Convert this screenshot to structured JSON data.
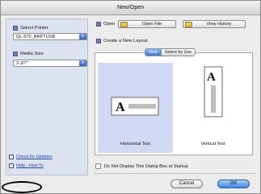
{
  "window": {
    "title": "New/Open"
  },
  "sidebar": {
    "printer": {
      "label": "Select Printer",
      "value": "QL-570_BRPTUSB"
    },
    "media": {
      "label": "Media Size",
      "value": "2-3/7\""
    },
    "links": [
      {
        "label": "Check for Updates"
      },
      {
        "label": "Help - How To"
      }
    ]
  },
  "open": {
    "label": "Open",
    "open_file_label": "Open File",
    "view_history_label": "View History"
  },
  "create": {
    "label": "Create a New Layout",
    "tabs": [
      {
        "label": "New",
        "active": true
      },
      {
        "label": "Select by Use",
        "active": false
      }
    ],
    "choices": [
      {
        "label": "Horizontal Text",
        "selected": true
      },
      {
        "label": "Vertical Text",
        "selected": false
      }
    ]
  },
  "startup_checkbox": {
    "label": "Do Not Display This Dialog Box at Startup",
    "checked": false
  },
  "buttons": {
    "cancel": "Cancel",
    "ok": "OK"
  },
  "colors": {
    "accent": "#3d85e0",
    "selection": "#d2d9f3",
    "link": "#1a43b5"
  }
}
